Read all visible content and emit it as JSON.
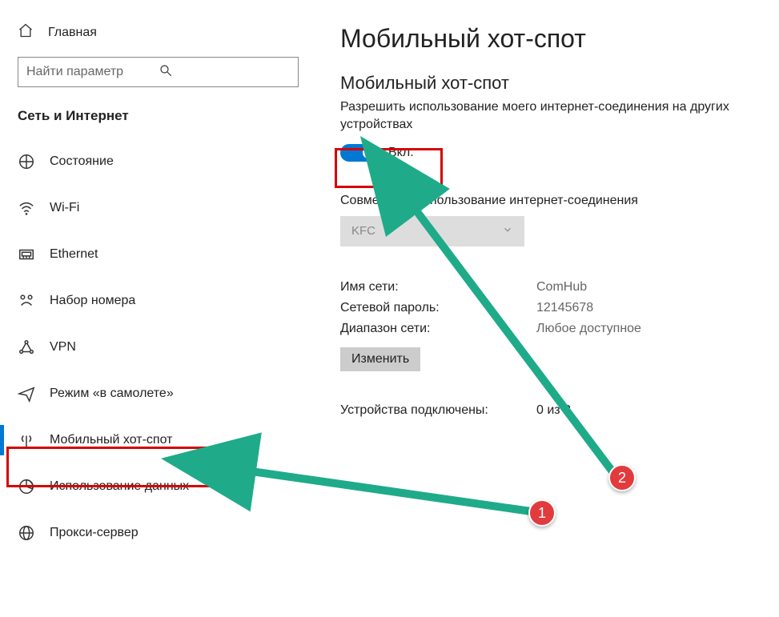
{
  "sidebar": {
    "home_label": "Главная",
    "search_placeholder": "Найти параметр",
    "category": "Сеть и Интернет",
    "items": [
      {
        "label": "Состояние"
      },
      {
        "label": "Wi-Fi"
      },
      {
        "label": "Ethernet"
      },
      {
        "label": "Набор номера"
      },
      {
        "label": "VPN"
      },
      {
        "label": "Режим «в самолете»"
      },
      {
        "label": "Мобильный хот-спот"
      },
      {
        "label": "Использование данных"
      },
      {
        "label": "Прокси-сервер"
      }
    ]
  },
  "main": {
    "title": "Мобильный хот-спот",
    "subtitle": "Мобильный хот-спот",
    "description": "Разрешить использование моего интернет-соединения на других устройствах",
    "toggle_label": "Вкл.",
    "share_label": "Совместное использование интернет-соединения",
    "share_value": "KFC",
    "network_name_label": "Имя сети:",
    "network_name_value": "ComHub",
    "network_password_label": "Сетевой пароль:",
    "network_password_value": "12145678",
    "network_band_label": "Диапазон сети:",
    "network_band_value": "Любое доступное",
    "change_button": "Изменить",
    "devices_label": "Устройства подключены:",
    "devices_value": "0 из 8"
  },
  "annotations": {
    "badge1": "1",
    "badge2": "2"
  }
}
